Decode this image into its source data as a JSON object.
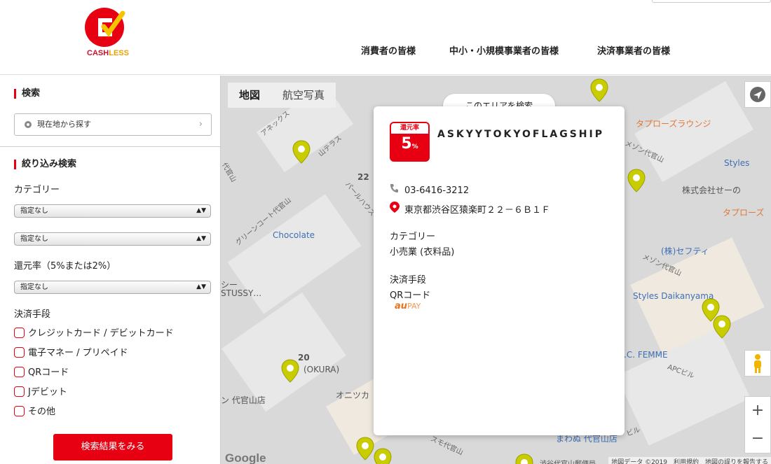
{
  "header": {
    "logo_text_1": "CASH",
    "logo_text_2": "LESS",
    "nav": [
      "消費者の皆様",
      "中小・小規模事業者の皆様",
      "決済事業者の皆様"
    ]
  },
  "sidebar": {
    "search_title": "検索",
    "current_location_button": "現在地から探す",
    "filter_title": "絞り込み検索",
    "category_label": "カテゴリー",
    "category_select_1": "指定なし",
    "category_select_2": "指定なし",
    "rate_label": "還元率（5%または2%）",
    "rate_select": "指定なし",
    "payment_label": "決済手段",
    "payment_options": [
      "クレジットカード / デビットカード",
      "電子マネー / プリペイド",
      "QRコード",
      "Jデビット",
      "その他"
    ],
    "result_button": "検索結果をみる"
  },
  "map": {
    "tabs": [
      "地図",
      "航空写真"
    ],
    "area_search_button": "このエリアを検索",
    "labels": {
      "annex": "アネックス",
      "hillside": "山テラス",
      "num22": "22",
      "pearl": "パールハウス",
      "daikanyama": "代官山",
      "greencourt": "グリーンコート代官山",
      "chocolate": "Chocolate",
      "stussy_1": "シー",
      "stussy_2": "STUSSY…",
      "num20": "20",
      "okura": "(OKURA)",
      "onitsuka": "オニツカ",
      "shop_daikanyama": "ン 代官山店",
      "taproom": "タプローズラウンジ",
      "maison": "メゾン代官山",
      "styles": "Styles",
      "semo": "株式会社せーの",
      "taproom2": "タプローズ",
      "sefuti": "(株)セフティ",
      "maison2": "メゾン代官山",
      "styles_daikanyama": "Styles Daikanyama",
      "cfemme": ".C. FEMME",
      "apc": "APCビル",
      "ru_building": "ビル",
      "mawanu": "まわぬ 代官山店",
      "post_office": "渋谷代官山郵便局",
      "sumo": "スモ代官山"
    },
    "google": "Google",
    "attribution": "地図データ ©2019　利用規約　地図の誤りを報告する"
  },
  "popup": {
    "badge_label": "還元率",
    "badge_rate": "5",
    "badge_unit": "%",
    "shop_name": "ASKYYTOKYOFLAGSHIP",
    "phone": "03-6416-3212",
    "address": "東京都渋谷区猿楽町２２－６Ｂ１Ｆ",
    "category_heading": "カテゴリー",
    "category_value": "小売業 (衣料品)",
    "payment_heading": "決済手段",
    "payment_value": "QRコード",
    "payment_logo_1": "au",
    "payment_logo_2": "PAY"
  },
  "colors": {
    "accent": "#e60012",
    "pin_yellow": "#c8cc00",
    "map_bg": "#d9d9d9"
  }
}
